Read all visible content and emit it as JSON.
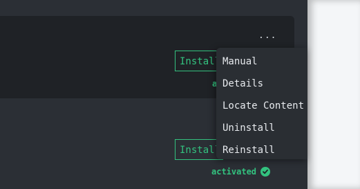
{
  "card1": {
    "more_label": "...",
    "install_label": "Install",
    "status_label": "activated"
  },
  "card2": {
    "install_label": "Install",
    "status_label": "activated"
  },
  "menu": {
    "items": [
      {
        "label": "Manual"
      },
      {
        "label": "Details"
      },
      {
        "label": "Locate Content"
      },
      {
        "label": "Uninstall"
      },
      {
        "label": "Reinstall"
      }
    ]
  },
  "colors": {
    "accent": "#33c27f",
    "panel": "#1f2226",
    "background": "#2b2f35",
    "menu": "#2a2e33"
  },
  "icons": [
    "more-icon",
    "check-circle-icon"
  ]
}
